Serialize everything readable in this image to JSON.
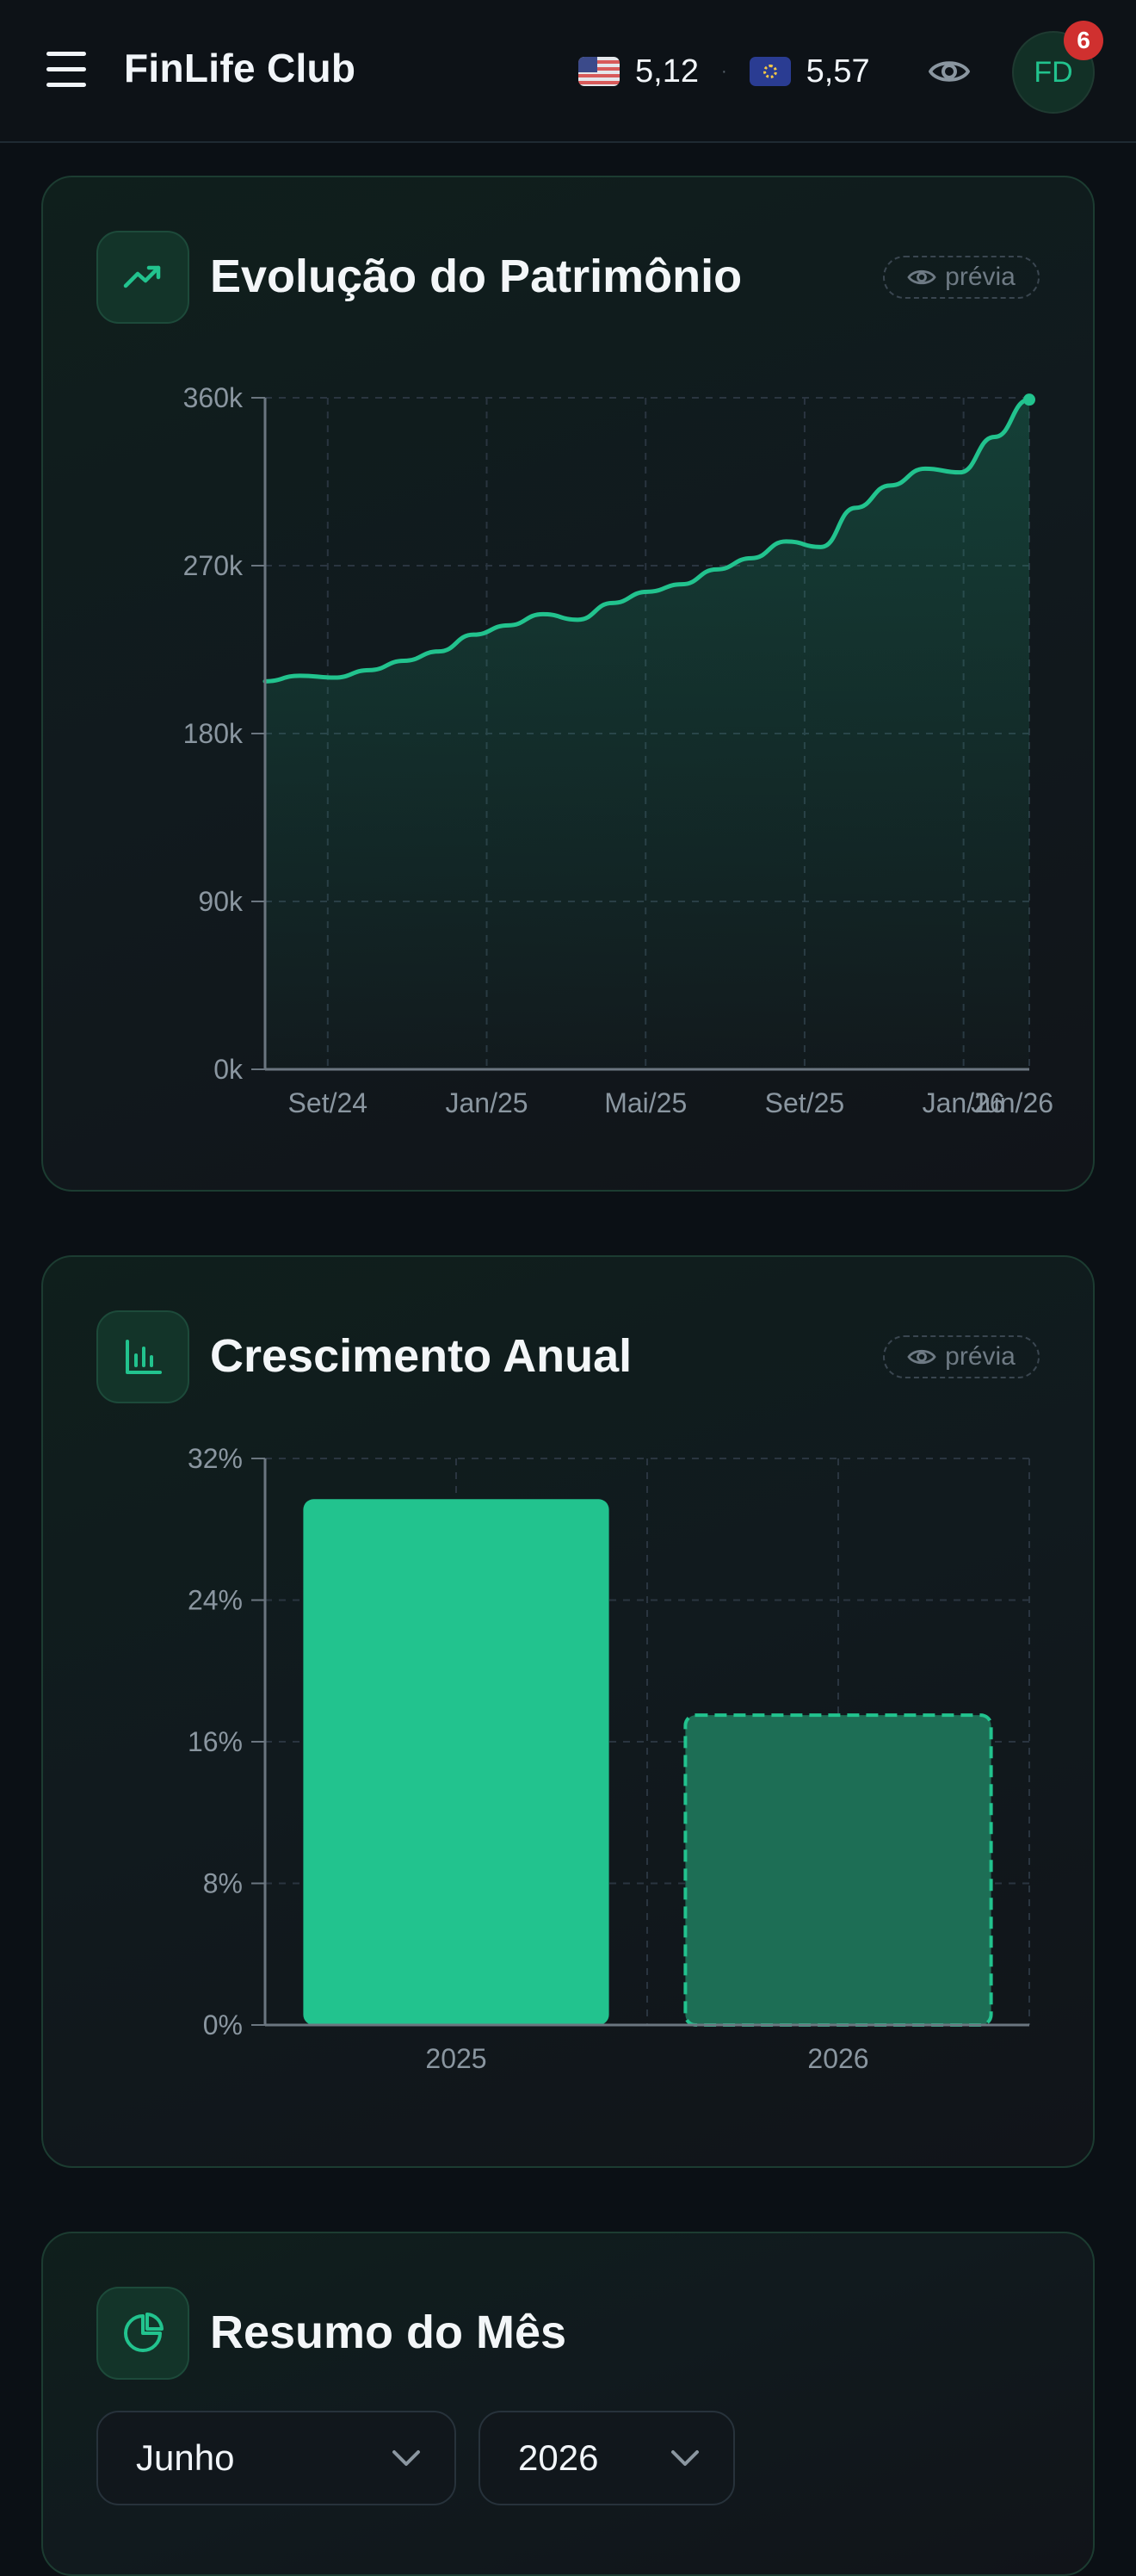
{
  "header": {
    "app_title": "FinLife Club",
    "usd_rate": "5,12",
    "eur_rate": "5,57",
    "separator": "·",
    "avatar_initials": "FD",
    "notification_count": "6"
  },
  "wealth_card": {
    "title": "Evolução do Patrimônio",
    "preview_label": "prévia",
    "icon": "trending-up-icon",
    "chart_data": {
      "type": "area",
      "x_tick_labels": [
        "Set/24",
        "Jan/25",
        "Mai/25",
        "Set/25",
        "Jan/26",
        "Jun/26"
      ],
      "y_tick_labels": [
        "0k",
        "90k",
        "180k",
        "270k",
        "360k"
      ],
      "ylim": [
        0,
        360000
      ],
      "grid": true,
      "series": [
        {
          "values": [
            208000,
            211000,
            210000,
            214000,
            219000,
            224000,
            233000,
            238000,
            244000,
            241000,
            250000,
            256000,
            260000,
            268000,
            274000,
            283000,
            280000,
            301000,
            313000,
            322000,
            320000,
            339000,
            359000
          ]
        }
      ]
    }
  },
  "growth_card": {
    "title": "Crescimento Anual",
    "preview_label": "prévia",
    "icon": "bar-chart-icon",
    "chart_data": {
      "type": "bar",
      "categories": [
        "2025",
        "2026"
      ],
      "values": [
        29.7,
        17.5
      ],
      "y_tick_labels": [
        "0%",
        "8%",
        "16%",
        "24%",
        "32%"
      ],
      "ylim": [
        0,
        32
      ],
      "grid": true,
      "projected": [
        false,
        true
      ]
    }
  },
  "summary_card": {
    "title": "Resumo do Mês",
    "icon": "pie-chart-icon",
    "month_select": "Junho",
    "year_select": "2026"
  },
  "colors": {
    "accent": "#22c38e",
    "background": "#0b1015",
    "badge": "#d0302f"
  }
}
